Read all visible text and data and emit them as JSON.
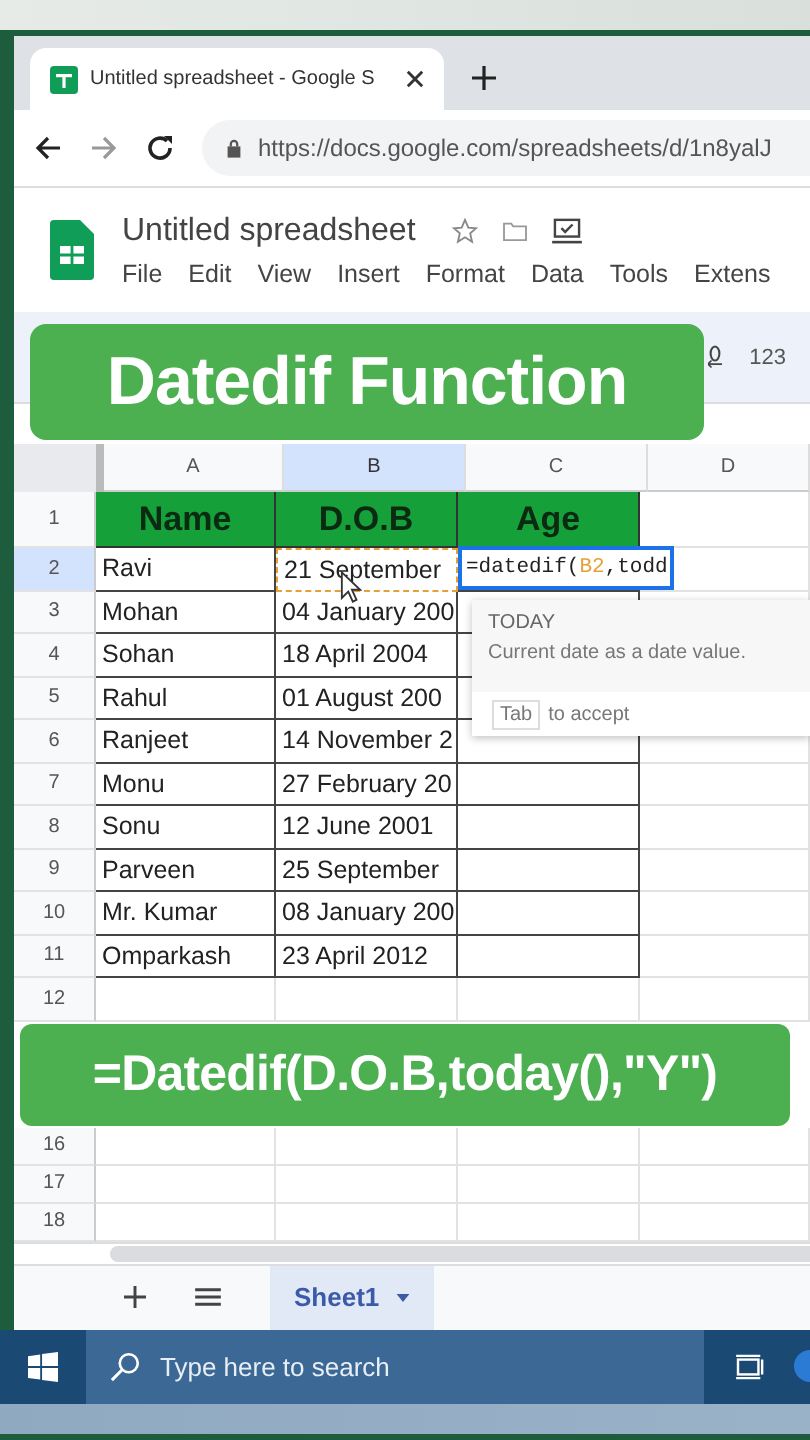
{
  "browser": {
    "tab_title": "Untitled spreadsheet - Google S",
    "url": "https://docs.google.com/spreadsheets/d/1n8yalJ"
  },
  "doc": {
    "title": "Untitled spreadsheet",
    "menu": [
      "File",
      "Edit",
      "View",
      "Insert",
      "Format",
      "Data",
      "Tools",
      "Extens"
    ]
  },
  "toolbar": {
    "number_format": "123"
  },
  "banner_title": "Datedif Function",
  "banner_formula": "=Datedif(D.O.B,today(),\"Y\")",
  "columns": [
    {
      "label": "A",
      "selected": false
    },
    {
      "label": "B",
      "selected": true
    },
    {
      "label": "C",
      "selected": false
    },
    {
      "label": "D",
      "selected": false
    }
  ],
  "rows": [
    {
      "number": "1",
      "kind": "header",
      "selected": false,
      "cells": [
        "Name",
        "D.O.B",
        "Age"
      ]
    },
    {
      "number": "2",
      "kind": "data",
      "selected": true,
      "referenced": true,
      "editing": true,
      "cells": [
        "Ravi",
        "21 September"
      ]
    },
    {
      "number": "3",
      "kind": "data",
      "selected": false,
      "referenced": false,
      "editing": false,
      "cells": [
        "Mohan",
        "04 January 200"
      ]
    },
    {
      "number": "4",
      "kind": "data",
      "selected": false,
      "referenced": false,
      "editing": false,
      "cells": [
        "Sohan",
        "18 April 2004"
      ]
    },
    {
      "number": "5",
      "kind": "data",
      "selected": false,
      "referenced": false,
      "editing": false,
      "cells": [
        "Rahul",
        "01 August 200"
      ]
    },
    {
      "number": "6",
      "kind": "data",
      "selected": false,
      "referenced": false,
      "editing": false,
      "cells": [
        "Ranjeet",
        "14 November 2"
      ]
    },
    {
      "number": "7",
      "kind": "data",
      "selected": false,
      "referenced": false,
      "editing": false,
      "cells": [
        "Monu",
        "27 February 20"
      ]
    },
    {
      "number": "8",
      "kind": "data",
      "selected": false,
      "referenced": false,
      "editing": false,
      "cells": [
        "Sonu",
        "12 June 2001"
      ]
    },
    {
      "number": "9",
      "kind": "data",
      "selected": false,
      "referenced": false,
      "editing": false,
      "cells": [
        "Parveen",
        "25 September"
      ]
    },
    {
      "number": "10",
      "kind": "data",
      "selected": false,
      "referenced": false,
      "editing": false,
      "cells": [
        "Mr. Kumar",
        "08 January 200"
      ]
    },
    {
      "number": "11",
      "kind": "data",
      "selected": false,
      "referenced": false,
      "editing": false,
      "cells": [
        "Omparkash",
        "23 April 2012"
      ]
    },
    {
      "number": "12",
      "kind": "empty",
      "selected": false,
      "cells": []
    }
  ],
  "lower_rows": [
    "16",
    "17",
    "18"
  ],
  "cell_editor": {
    "parts": [
      {
        "kind": "text",
        "text": "=datedif("
      },
      {
        "kind": "ref",
        "text": "B2"
      },
      {
        "kind": "text",
        "text": ",todd"
      }
    ]
  },
  "suggestion": {
    "name": "TODAY",
    "description": "Current date as a date value.",
    "key": "Tab",
    "hint": "to accept"
  },
  "sheets": [
    {
      "label": "Sheet1",
      "selected": true
    }
  ],
  "taskbar": {
    "search_placeholder": "Type here to search"
  }
}
